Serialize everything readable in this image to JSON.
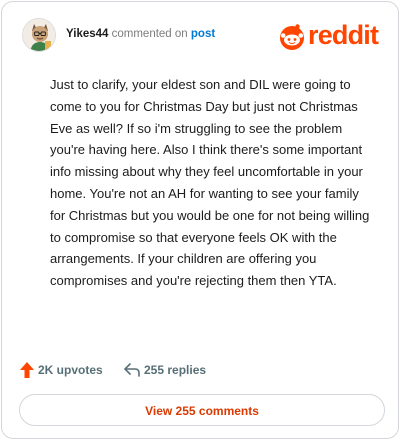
{
  "header": {
    "username": "Yikes44",
    "verb": "commented on",
    "target": "post",
    "brand": "reddit",
    "avatar_icon": "user-avatar-icon",
    "logo_icon": "reddit-snoo-icon",
    "brand_color": "#ff4500"
  },
  "comment": {
    "body": "Just to clarify, your eldest son and DIL were going to come to you for Christmas Day but just not Christmas Eve as well? If so i'm struggling to see the problem you're having here. Also I think there's some important info missing about why they feel uncomfortable in your home. You're not an AH for wanting to see your family for Christmas but you would be one for not being willing to compromise so that everyone feels OK with the arrangements. If your children are offering you compromises and you're rejecting them then YTA."
  },
  "actions": {
    "upvotes": "2K upvotes",
    "replies": "255 replies",
    "upvote_icon": "upvote-arrow-icon",
    "reply_icon": "reply-arrow-icon"
  },
  "footer": {
    "view_comments": "View 255 comments"
  }
}
